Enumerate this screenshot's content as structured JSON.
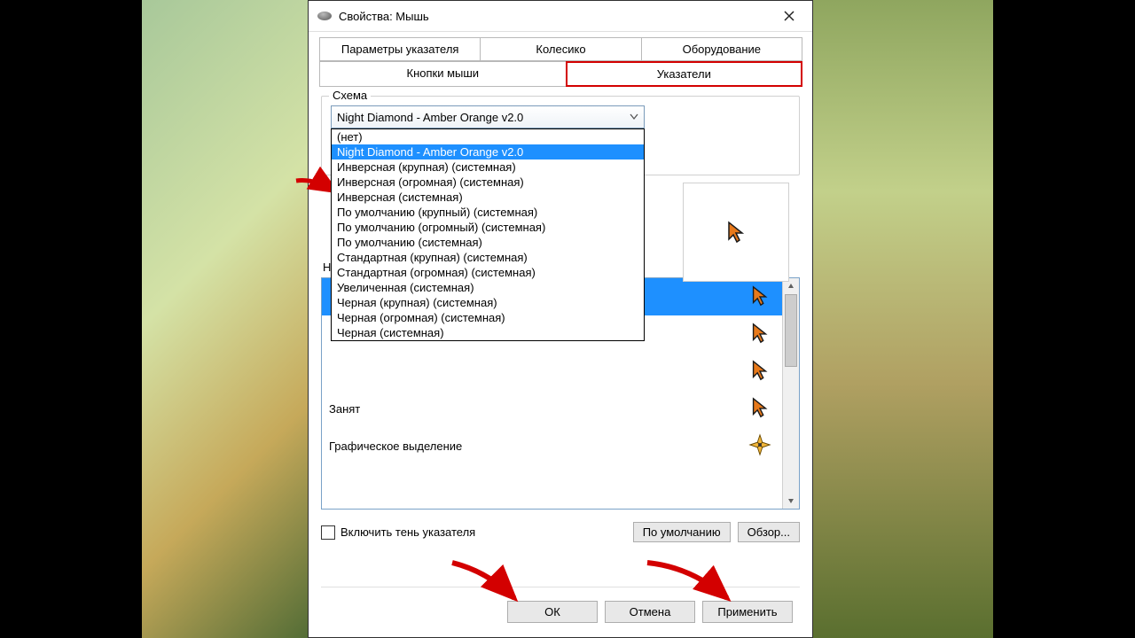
{
  "window": {
    "title": "Свойства: Мышь"
  },
  "tabs": {
    "row1": [
      "Параметры указателя",
      "Колесико",
      "Оборудование"
    ],
    "row2": [
      "Кнопки мыши",
      "Указатели"
    ],
    "active": "Указатели"
  },
  "scheme": {
    "group_label": "Схема",
    "selected": "Night Diamond - Amber Orange v2.0",
    "options": [
      "(нет)",
      "Night Diamond - Amber Orange v2.0",
      "Инверсная (крупная) (системная)",
      "Инверсная (огромная) (системная)",
      "Инверсная (системная)",
      "По умолчанию (крупный) (системная)",
      "По умолчанию (огромный) (системная)",
      "По умолчанию (системная)",
      "Стандартная (крупная) (системная)",
      "Стандартная (огромная) (системная)",
      "Увеличенная (системная)",
      "Черная (крупная) (системная)",
      "Черная (огромная) (системная)",
      "Черная (системная)"
    ],
    "highlighted_index": 1
  },
  "settings": {
    "customize_label": "Настройка",
    "cursor_types": [
      {
        "label": "",
        "icon": "cursor"
      },
      {
        "label": "",
        "icon": "cursor"
      },
      {
        "label": "",
        "icon": "cursor"
      },
      {
        "label": "Занят",
        "icon": "cursor"
      },
      {
        "label": "Графическое выделение",
        "icon": "star"
      }
    ],
    "selected_row_index": 0
  },
  "checkbox": {
    "label": "Включить тень указателя",
    "checked": false
  },
  "buttons": {
    "defaults": "По умолчанию",
    "browse": "Обзор...",
    "ok": "ОК",
    "cancel": "Отмена",
    "apply": "Применить"
  },
  "colors": {
    "highlight_red": "#d30000",
    "selection_blue": "#1e90ff",
    "cursor_orange": "#e8791a"
  }
}
